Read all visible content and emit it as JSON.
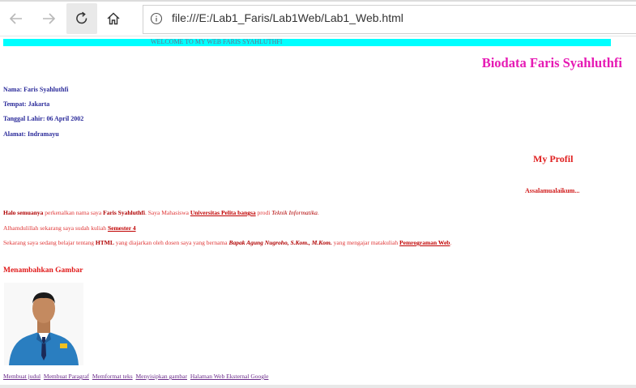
{
  "browser": {
    "url": "file:///E:/Lab1_Faris/Lab1Web/Lab1_Web.html",
    "icons": {
      "back": "arrow-left-icon",
      "forward": "arrow-right-icon",
      "refresh": "refresh-icon",
      "home": "home-icon",
      "info": "info-icon"
    }
  },
  "page": {
    "marquee_text": "WELCOME TO MY WEB FARIS SYAHLUTHFI",
    "bio_title": "Biodata Faris Syahluthfi",
    "bio": {
      "nama": "Nama: Faris Syahluthfi",
      "tempat": "Tempat: Jakarta",
      "ttl": "Tanggal Lahir: 06 April 2002",
      "alamat": "Alamat: Indramayu"
    },
    "profil_title": "My Profil",
    "greeting": "Assalamualaikum...",
    "p1": {
      "a": "Halo semuanya",
      "b": " perkenalkan nama saya ",
      "c": "Faris Syahluthfi",
      "d": ". Saya Mahasiswa ",
      "e": "Universitas Pelita bangsa",
      "f": " prodi ",
      "g": "Teknik Informatika",
      "h": "."
    },
    "p2": {
      "a": "Alhamdulillah sekarang saya sudah kuliah ",
      "b": "Semester 4"
    },
    "p3": {
      "a": "Sekarang saya sedang belajar tentang ",
      "b": "HTML",
      "c": " yang diajarkan oleh dosen saya yang bernama ",
      "d": "Bapak Agung Nugroho, S.Kom., M.Kom.",
      "e": " yang mengajar matakuliah ",
      "f": "Pemrograman Web",
      "g": "."
    },
    "gambar_title": "Menambahkan Gambar",
    "links": [
      "Membuat judul",
      "Membuat Paragraf",
      "Memformat teks",
      "Menyisipkan gambar",
      "Halaman Web Eksternal Google"
    ]
  }
}
